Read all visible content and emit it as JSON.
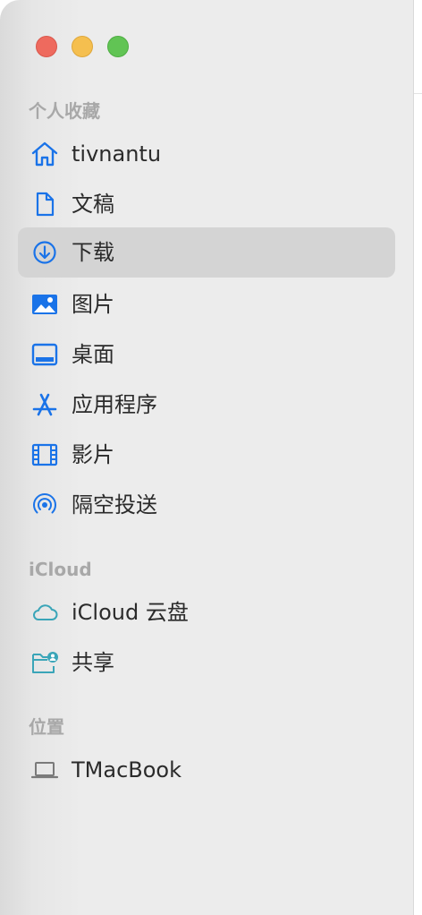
{
  "window": {
    "traffic_lights": [
      "close",
      "minimize",
      "zoom"
    ]
  },
  "sidebar": {
    "sections": [
      {
        "header": "个人收藏",
        "items": [
          {
            "label": "tivnantu",
            "icon": "home-icon"
          },
          {
            "label": "文稿",
            "icon": "document-icon"
          },
          {
            "label": "下载",
            "icon": "download-icon",
            "selected": true
          },
          {
            "label": "图片",
            "icon": "photo-icon"
          },
          {
            "label": "桌面",
            "icon": "desktop-icon"
          },
          {
            "label": "应用程序",
            "icon": "applications-icon"
          },
          {
            "label": "影片",
            "icon": "film-icon"
          },
          {
            "label": "隔空投送",
            "icon": "airdrop-icon"
          }
        ]
      },
      {
        "header": "iCloud",
        "items": [
          {
            "label": "iCloud 云盘",
            "icon": "icloud-icon"
          },
          {
            "label": "共享",
            "icon": "shared-folder-icon"
          }
        ]
      },
      {
        "header": "位置",
        "items": [
          {
            "label": "TMacBook",
            "icon": "laptop-icon"
          }
        ]
      }
    ]
  },
  "colors": {
    "accent": "#1a73e8",
    "icloud_icon": "#3aa5b8",
    "laptop_icon": "#7a7a7a",
    "selection": "#d4d4d4",
    "section_header": "#a8a8a8"
  }
}
